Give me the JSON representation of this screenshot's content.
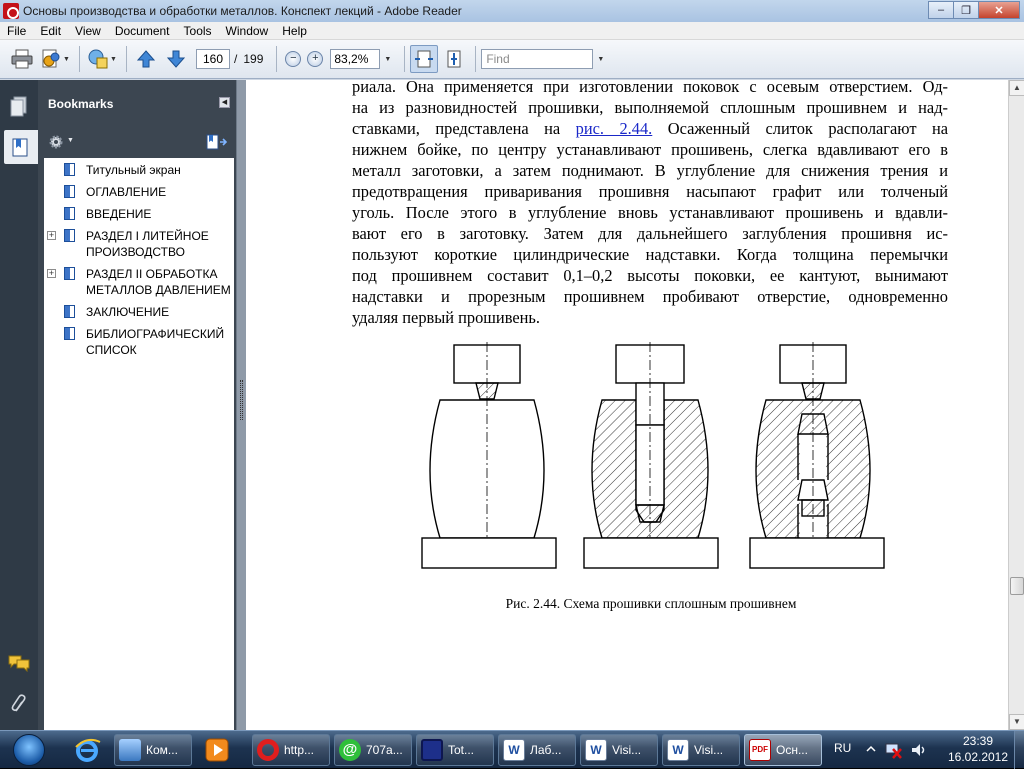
{
  "window": {
    "title": "Основы производства и обработки металлов. Конспект лекций - Adobe Reader",
    "min_symbol": "–",
    "max_symbol": "❐",
    "close_symbol": "✕"
  },
  "menu": [
    "File",
    "Edit",
    "View",
    "Document",
    "Tools",
    "Window",
    "Help"
  ],
  "toolbar": {
    "current_page": "160",
    "page_separator": "/",
    "total_pages": "199",
    "zoom_out_symbol": "−",
    "zoom_in_symbol": "+",
    "zoom": "83,2%",
    "find_placeholder": "Find"
  },
  "bookmarks": {
    "title": "Bookmarks",
    "items": [
      {
        "label": "Титульный экран",
        "expandable": false
      },
      {
        "label": "ОГЛАВЛЕНИЕ",
        "expandable": false
      },
      {
        "label": "ВВЕДЕНИЕ",
        "expandable": false
      },
      {
        "label_lines": [
          "РАЗДЕЛ I  ЛИТЕЙНОЕ",
          "ПРОИЗВОДСТВО"
        ],
        "expandable": true
      },
      {
        "label_lines": [
          "РАЗДЕЛ II ОБРАБОТКА",
          "МЕТАЛЛОВ ДАВЛЕНИЕМ"
        ],
        "expandable": true
      },
      {
        "label": "ЗАКЛЮЧЕНИЕ",
        "expandable": false
      },
      {
        "label_lines": [
          "БИБЛИОГРАФИЧЕСКИЙ",
          "СПИСОК"
        ],
        "expandable": false
      }
    ]
  },
  "document": {
    "lines": [
      "риала. Она применяется при изготовлении поковок с осевым отверстием. Од-",
      "на из разновидностей прошивки, выполняемой сплошным прошивнем и над-",
      "ставками, представлена на |рис. 2.44.| Осаженный слиток располагают на",
      "нижнем бойке, по центру устанавливают прошивень, слегка вдавливают его в",
      "металл заготовки, а затем поднимают. В углубление для снижения трения и",
      "предотвращения приваривания прошивня насыпают графит или толченый",
      "уголь. После этого в углубление вновь устанавливают прошивень и вдавли-",
      "вают его в заготовку. Затем для дальнейшего заглубления прошивня ис-",
      "пользуют короткие цилиндрические надставки. Когда толщина перемычки",
      "под прошивнем составит 0,1–0,2 высоты поковки, ее кантуют, вынимают",
      "надставки и прорезным прошивнем пробивают отверстие, одновременно",
      "удаляя первый прошивень."
    ],
    "line1_a": "риала. Она применяется при изготовлении поковок с осевым отверстием. Од-",
    "line2": "на из разновидностей прошивки, выполняемой сплошным прошивнем и над-",
    "line3_before": "ставками, представлена на ",
    "line3_link": "рис. 2.44.",
    "line3_after": " Осаженный слиток располагают на",
    "line4": "нижнем бойке, по центру устанавливают прошивень, слегка вдавливают его в",
    "line5": "металл заготовки, а затем поднимают. В углубление для снижения трения и",
    "line6": "предотвращения приваривания прошивня насыпают графит или толченый",
    "line7": "уголь. После этого в углубление вновь устанавливают прошивень и вдавли-",
    "line8": "вают его в заготовку. Затем для дальнейшего заглубления прошивня ис-",
    "line9": "пользуют короткие цилиндрические надставки. Когда толщина перемычки",
    "line10": "под прошивнем составит 0,1–0,2 высоты поковки, ее кантуют, вынимают",
    "line11": "надставки и прорезным прошивнем пробивают отверстие, одновременно",
    "line12": "удаляя первый прошивень.",
    "caption": "Рис. 2.44. Схема прошивки сплошным прошивнем"
  },
  "taskbar": {
    "buttons": [
      "Ком...",
      "http...",
      "707а...",
      "Tot...",
      "Лаб...",
      "Visi...",
      "Visi...",
      "Осн..."
    ],
    "language": "RU",
    "time": "23:39",
    "date": "16.02.2012"
  },
  "colors": {
    "link": "#1a28c8",
    "panel_dark": "#3c4651",
    "taskbar": "#1d3350"
  }
}
